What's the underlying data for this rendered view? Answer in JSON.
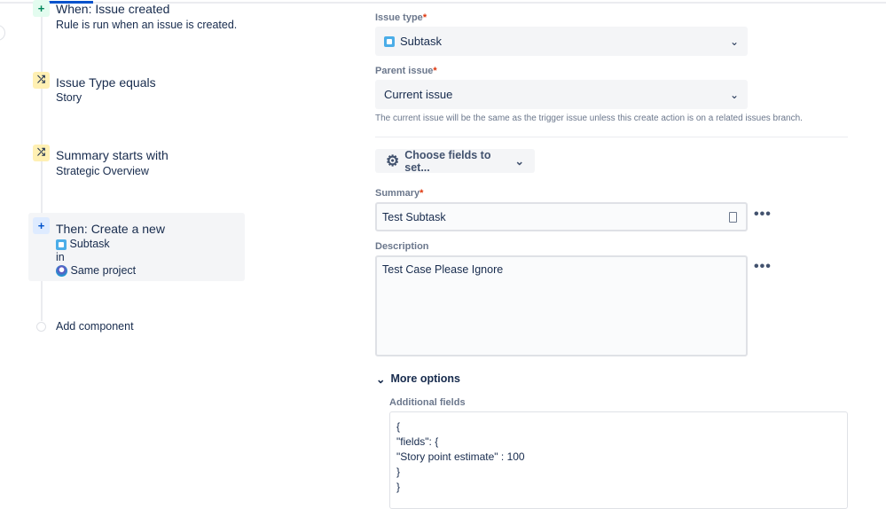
{
  "rule": {
    "trigger": {
      "title": "When: Issue created",
      "desc": "Rule is run when an issue is created."
    },
    "conditions": [
      {
        "title": "Issue Type equals",
        "value": "Story"
      },
      {
        "title": "Summary starts with",
        "value": "Strategic Overview"
      }
    ],
    "action": {
      "title": "Then: Create a new",
      "issue_type": "Subtask",
      "in": "in",
      "project": "Same project"
    },
    "add_component": "Add component"
  },
  "form": {
    "issue_type": {
      "label": "Issue type",
      "required": "*",
      "value": "Subtask"
    },
    "parent_issue": {
      "label": "Parent issue",
      "required": "*",
      "value": "Current issue",
      "help": "The current issue will be the same as the trigger issue unless this create action is on a related issues branch."
    },
    "choose_fields": "Choose fields to set...",
    "summary": {
      "label": "Summary",
      "required": "*",
      "value": "Test Subtask"
    },
    "description": {
      "label": "Description",
      "value": "Test Case Please Ignore"
    },
    "more_options": "More options",
    "additional_fields": {
      "label": "Additional fields",
      "lines": [
        "{",
        "\"fields\": {",
        "\"Story point estimate\" : 100",
        "}",
        "}"
      ]
    },
    "dots": "•••"
  }
}
